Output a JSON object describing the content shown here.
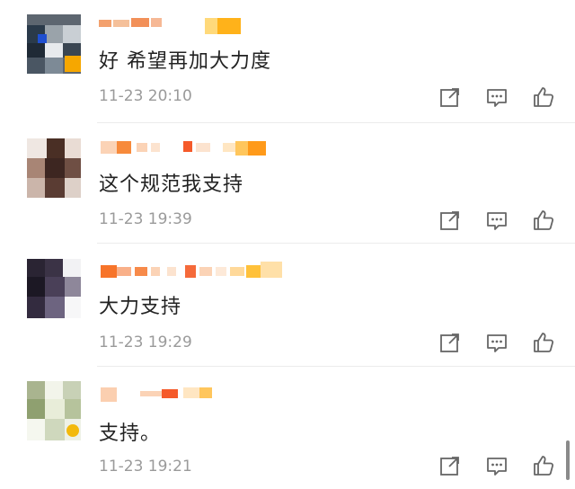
{
  "comments": [
    {
      "text": "好  希望再加大力度",
      "time": "11-23 20:10"
    },
    {
      "text": "这个规范我支持",
      "time": "11-23 19:39"
    },
    {
      "text": "大力支持",
      "time": "11-23 19:29"
    },
    {
      "text": "支持。",
      "time": "11-23 19:21"
    }
  ],
  "icons": {
    "share": "share-icon",
    "reply": "reply-icon",
    "like": "thumbs-up-icon"
  },
  "colors": {
    "username": "#ff8200",
    "text": "#222222",
    "meta": "#9a9a9a",
    "icon": "#666666"
  }
}
